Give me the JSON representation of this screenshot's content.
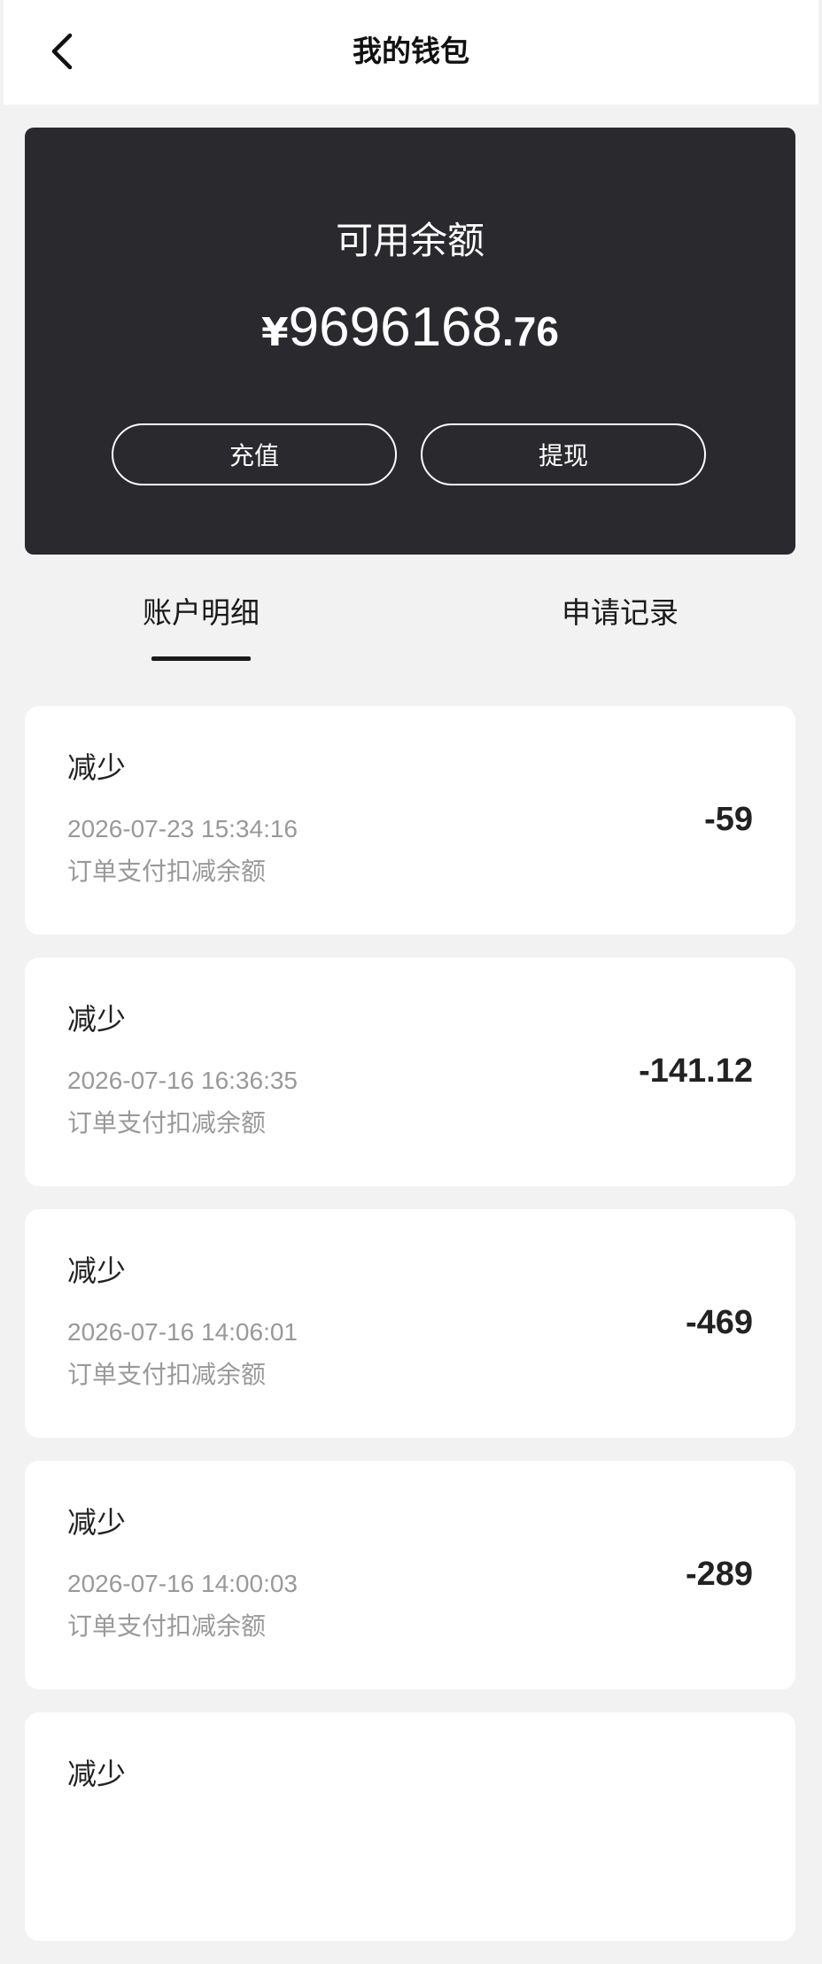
{
  "header": {
    "title": "我的钱包",
    "back_icon": "chevron-left-icon"
  },
  "balance": {
    "label": "可用余额",
    "currency_symbol": "¥",
    "integer_part": "9696168",
    "decimal_part": ".76",
    "recharge_label": "充值",
    "withdraw_label": "提现"
  },
  "tabs": [
    {
      "label": "账户明细",
      "active": true
    },
    {
      "label": "申请记录",
      "active": false
    }
  ],
  "transactions": [
    {
      "type": "减少",
      "time": "2026-07-23 15:34:16",
      "desc": "订单支付扣减余额",
      "amount": "-59"
    },
    {
      "type": "减少",
      "time": "2026-07-16 16:36:35",
      "desc": "订单支付扣减余额",
      "amount": "-141.12"
    },
    {
      "type": "减少",
      "time": "2026-07-16 14:06:01",
      "desc": "订单支付扣减余额",
      "amount": "-469"
    },
    {
      "type": "减少",
      "time": "2026-07-16 14:00:03",
      "desc": "订单支付扣减余额",
      "amount": "-289"
    },
    {
      "type": "减少",
      "time": "",
      "desc": "",
      "amount": ""
    }
  ],
  "colors": {
    "card_background": "#2a2a2e",
    "page_background": "#f2f2f2",
    "muted_text": "#999999"
  }
}
